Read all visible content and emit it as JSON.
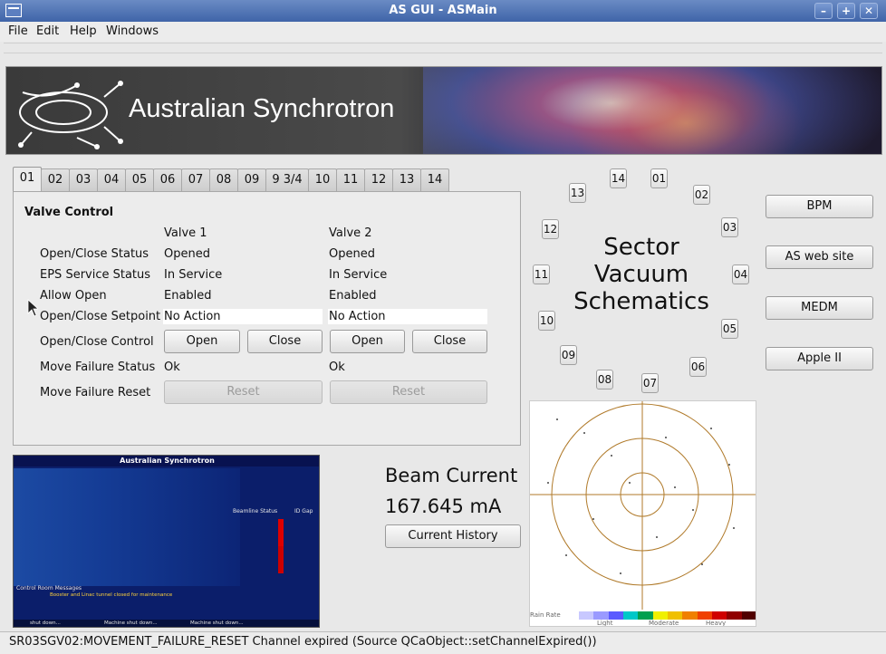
{
  "window": {
    "title": "AS GUI - ASMain"
  },
  "menu": [
    "File",
    "Edit",
    "Help",
    "Windows"
  ],
  "banner": {
    "name": "Australian Synchrotron"
  },
  "tabs": [
    "01",
    "02",
    "03",
    "04",
    "05",
    "06",
    "07",
    "08",
    "09",
    "9 3/4",
    "10",
    "11",
    "12",
    "13",
    "14"
  ],
  "active_tab": "01",
  "valve": {
    "title": "Valve Control",
    "col1": "Valve 1",
    "col2": "Valve 2",
    "rows": {
      "status": "Open/Close Status",
      "eps": "EPS Service Status",
      "allow": "Allow Open",
      "setpoint": "Open/Close Setpoint",
      "control": "Open/Close Control",
      "mfstatus": "Move Failure Status",
      "mfreset": "Move Failure Reset"
    },
    "v1": {
      "status": "Opened",
      "eps": "In Service",
      "allow": "Enabled",
      "setpoint": "No Action",
      "mfstatus": "Ok"
    },
    "v2": {
      "status": "Opened",
      "eps": "In Service",
      "allow": "Enabled",
      "setpoint": "No Action",
      "mfstatus": "Ok"
    },
    "open_label": "Open",
    "close_label": "Close",
    "reset_label": "Reset"
  },
  "sectors": {
    "title_line1": "Sector",
    "title_line2": "Vacuum",
    "title_line3": "Schematics",
    "labels": [
      "14",
      "01",
      "02",
      "03",
      "04",
      "05",
      "06",
      "07",
      "08",
      "09",
      "10",
      "11",
      "12",
      "13"
    ]
  },
  "side_buttons": [
    "BPM",
    "AS web site",
    "MEDM",
    "Apple II"
  ],
  "beam": {
    "label": "Beam Current",
    "value": "167.645 mA",
    "history_button": "Current History"
  },
  "thumbnail": {
    "title": "Australian Synchrotron",
    "beamline_status": "Beamline Status",
    "messages_label": "Control Room Messages",
    "message": "Booster and Linac tunnel closed for maintenance",
    "shutdown": "shut down...",
    "machine_shutdown": "Machine shut down...",
    "id_gap": "ID Gap"
  },
  "map": {
    "legend_label": "Rain Rate",
    "legend_light": "Light",
    "legend_moderate": "Moderate",
    "legend_heavy": "Heavy",
    "legend_colors": [
      "#c8c8ff",
      "#9a9aff",
      "#5a5aff",
      "#00c8c8",
      "#00a050",
      "#f0f000",
      "#f0c000",
      "#f08000",
      "#f04000",
      "#d00000",
      "#900000",
      "#500000"
    ]
  },
  "status": "SR03SGV02:MOVEMENT_FAILURE_RESET Channel expired (Source QCaObject::setChannelExpired())"
}
